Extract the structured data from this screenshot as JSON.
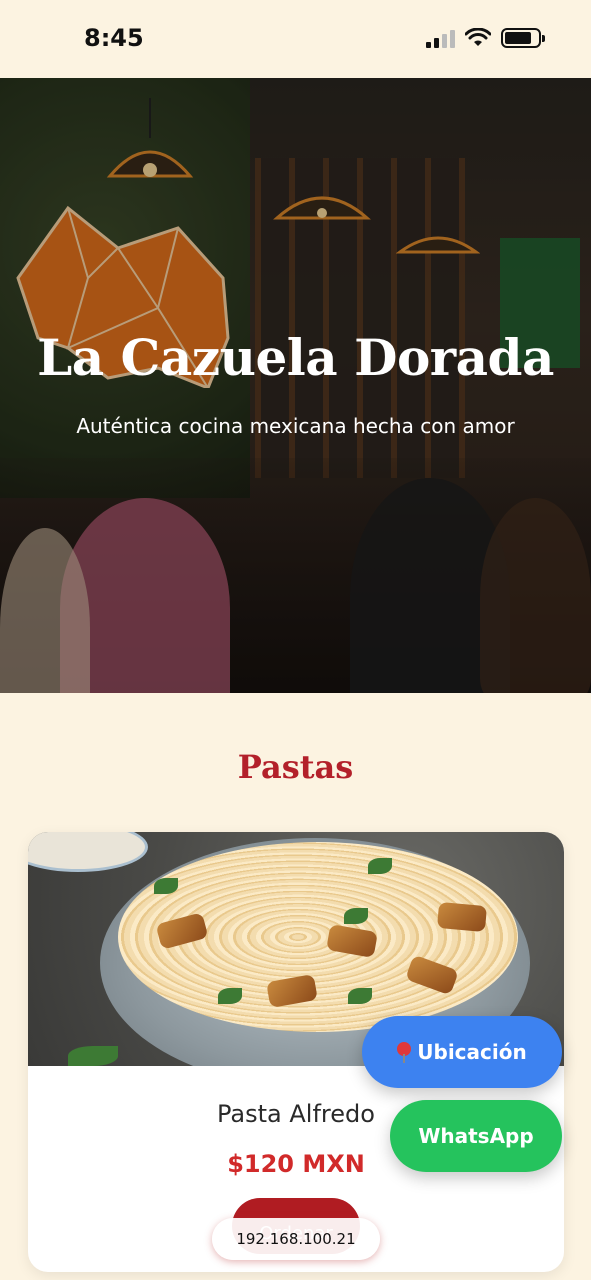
{
  "status_bar": {
    "time": "8:45",
    "battery_level": 0.8,
    "signal_bars": 2
  },
  "hero": {
    "title": "La Cazuela Dorada",
    "subtitle": "Auténtica cocina mexicana hecha con amor"
  },
  "menu": {
    "section_title": "Pastas",
    "items": [
      {
        "name": "Pasta Alfredo",
        "price": "$120 MXN",
        "order_label": "Ordenar"
      }
    ]
  },
  "floating": {
    "location_label": "Ubicación",
    "whatsapp_label": "WhatsApp"
  },
  "browser": {
    "address": "192.168.100.21"
  },
  "colors": {
    "background": "#fcf3e1",
    "accent_red": "#b3202a",
    "price_red": "#d12a2a",
    "location_blue": "#3d82f0",
    "whatsapp_green": "#25c35d"
  },
  "icons": {
    "location": "map-pin-icon",
    "signal": "cellular-signal-icon",
    "wifi": "wifi-icon",
    "battery": "battery-icon"
  }
}
